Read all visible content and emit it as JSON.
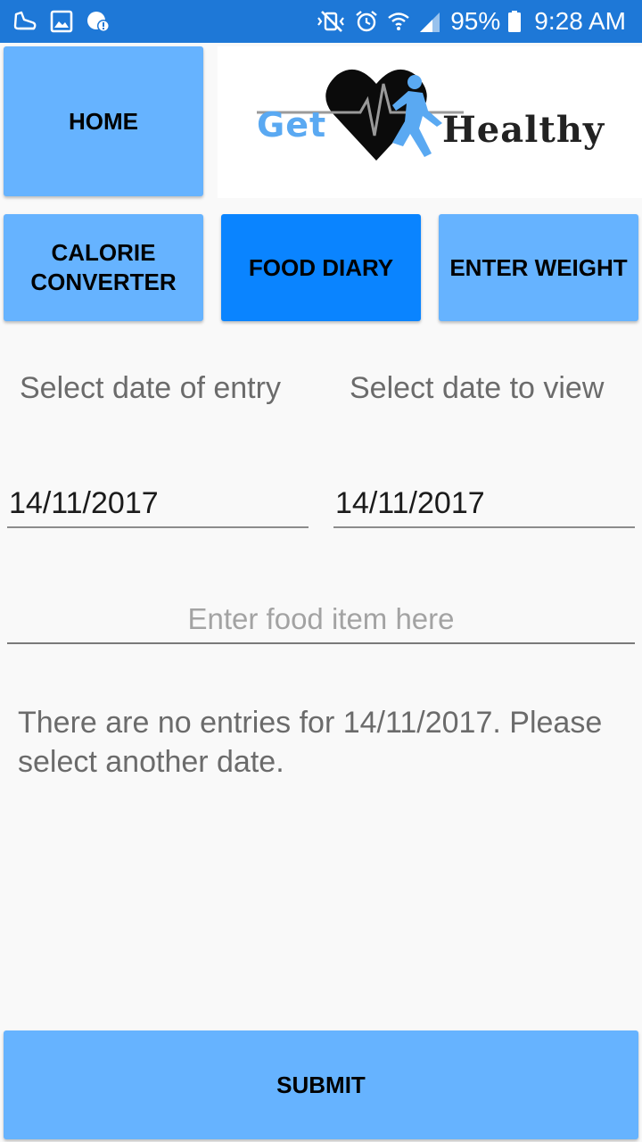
{
  "status_bar": {
    "battery_percent": "95%",
    "time": "9:28 AM",
    "left_icons": [
      "running-shoe-icon",
      "image-icon",
      "sync-alert-icon"
    ],
    "right_icons": [
      "vibrate-mute-icon",
      "alarm-icon",
      "wifi-icon",
      "signal-icon",
      "battery-icon"
    ],
    "background_color": "#1e78d7"
  },
  "header": {
    "home_label": "HOME",
    "logo_text_left": "Get",
    "logo_text_right": "Healthy"
  },
  "nav": {
    "calorie_converter_label": "CALORIE CONVERTER",
    "food_diary_label": "FOOD DIARY",
    "enter_weight_label": "ENTER WEIGHT",
    "active": "FOOD DIARY",
    "button_color": "#66b3ff",
    "active_color": "#0a84ff"
  },
  "form": {
    "entry_date_label": "Select date of entry",
    "view_date_label": "Select date to view",
    "entry_date_value": "14/11/2017",
    "view_date_value": "14/11/2017",
    "food_item_placeholder": "Enter food item here",
    "food_item_value": ""
  },
  "message": {
    "text": "There are no entries for 14/11/2017. Please select another date."
  },
  "submit": {
    "label": "SUBMIT"
  }
}
